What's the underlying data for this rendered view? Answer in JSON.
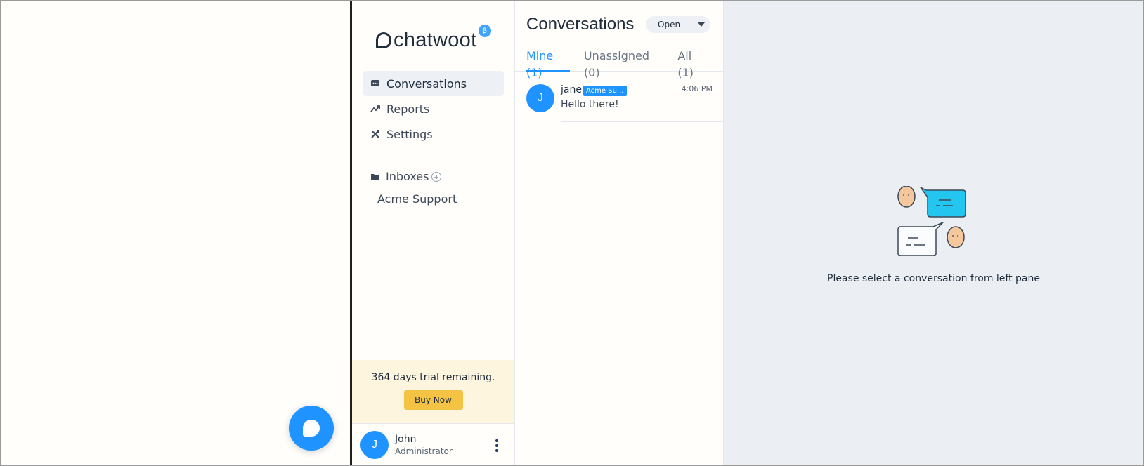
{
  "app": {
    "logo_text": "chatwoot",
    "beta_badge": "β",
    "accent_color": "#1f93ff"
  },
  "sidebar": {
    "nav": [
      {
        "label": "Conversations",
        "icon": "chat-icon",
        "active": true
      },
      {
        "label": "Reports",
        "icon": "trend-up-icon",
        "active": false
      },
      {
        "label": "Settings",
        "icon": "tools-icon",
        "active": false
      }
    ],
    "inboxes_label": "Inboxes",
    "inboxes": [
      "Acme Support"
    ],
    "trial_text": "364 days trial remaining.",
    "buy_now_label": "Buy Now",
    "profile": {
      "initial": "J",
      "name": "John",
      "role": "Administrator"
    }
  },
  "conversation_list": {
    "title": "Conversations",
    "status_filter": "Open",
    "tabs": [
      {
        "label": "Mine (1)",
        "active": true
      },
      {
        "label": "Unassigned (0)",
        "active": false
      },
      {
        "label": "All (1)",
        "active": false
      }
    ],
    "items": [
      {
        "initial": "J",
        "name": "jane",
        "inbox_tag": "Acme Su...",
        "time": "4:06 PM",
        "message": "Hello there!"
      }
    ]
  },
  "empty_state": {
    "message": "Please select a conversation from left pane"
  }
}
